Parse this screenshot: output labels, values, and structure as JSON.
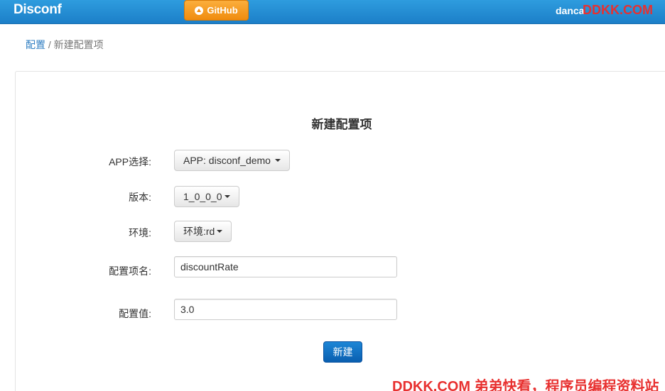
{
  "navbar": {
    "brand": "Disconf",
    "github_label": "GitHub",
    "user": "danca"
  },
  "watermark_top": "DDKK.COM",
  "breadcrumb": {
    "link": "配置",
    "separator": " / ",
    "current": "新建配置项"
  },
  "form": {
    "title": "新建配置项",
    "app": {
      "label": "APP选择:",
      "value": "APP: disconf_demo"
    },
    "version": {
      "label": "版本:",
      "value": "1_0_0_0"
    },
    "env": {
      "label": "环境:",
      "value": "环境:rd"
    },
    "key": {
      "label": "配置项名:",
      "value": "discountRate"
    },
    "val": {
      "label": "配置值:",
      "value": "3.0"
    },
    "submit_label": "新建"
  },
  "watermark_bottom": "DDKK.COM 弟弟快看，程序员编程资料站",
  "colors": {
    "navbar": "#1c7fc8",
    "github": "#f08c0e",
    "primary": "#0a5fb0",
    "watermark": "#e8302f"
  }
}
